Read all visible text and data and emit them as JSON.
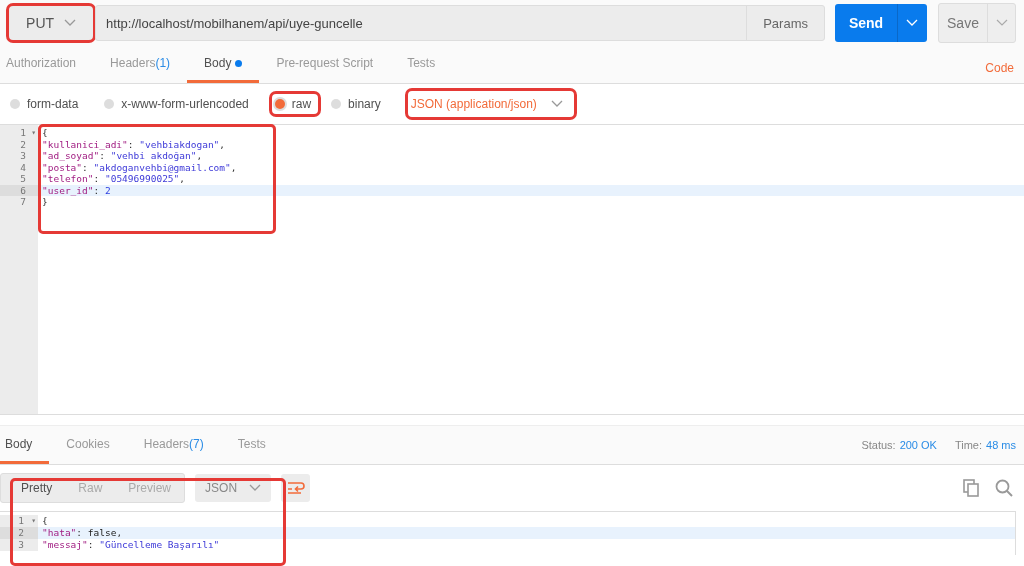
{
  "request": {
    "method": "PUT",
    "method_highlighted": true,
    "url": "http://localhost/mobilhanem/api/uye-guncelle",
    "params_button": "Params",
    "send_button": "Send",
    "save_button": "Save"
  },
  "request_tabs": [
    {
      "label": "Authorization",
      "dot": false,
      "selected": false
    },
    {
      "label": "Headers",
      "count": "(1)",
      "dot": false,
      "selected": false
    },
    {
      "label": "Body",
      "dot": true,
      "selected": true
    },
    {
      "label": "Pre-request Script",
      "dot": false,
      "selected": false
    },
    {
      "label": "Tests",
      "dot": false,
      "selected": false
    }
  ],
  "code_link": "Code",
  "body_types": [
    {
      "label": "form-data",
      "selected": false,
      "highlighted": false
    },
    {
      "label": "x-www-form-urlencoded",
      "selected": false,
      "highlighted": false
    },
    {
      "label": "raw",
      "selected": true,
      "highlighted": true
    },
    {
      "label": "binary",
      "selected": false,
      "highlighted": false
    }
  ],
  "content_type": {
    "label": "JSON (application/json)",
    "highlighted": true
  },
  "request_body": {
    "highlighted": true,
    "lines": [
      {
        "number": "1",
        "fold": "▾",
        "current": false,
        "tokens": [
          {
            "kind": "punct",
            "text": "{"
          }
        ]
      },
      {
        "number": "2",
        "current": false,
        "tokens": [
          {
            "kind": "key",
            "text": "\"kullanici_adi\""
          },
          {
            "kind": "punct",
            "text": ": "
          },
          {
            "kind": "string",
            "text": "\"vehbiakdogan\""
          },
          {
            "kind": "punct",
            "text": ","
          }
        ]
      },
      {
        "number": "3",
        "current": false,
        "tokens": [
          {
            "kind": "key",
            "text": "\"ad_soyad\""
          },
          {
            "kind": "punct",
            "text": ": "
          },
          {
            "kind": "string",
            "text": "\"vehbi akdoğan\""
          },
          {
            "kind": "punct",
            "text": ","
          }
        ]
      },
      {
        "number": "4",
        "current": false,
        "tokens": [
          {
            "kind": "key",
            "text": "\"posta\""
          },
          {
            "kind": "punct",
            "text": ": "
          },
          {
            "kind": "string",
            "text": "\"akdoganvehbi@gmail.com\""
          },
          {
            "kind": "punct",
            "text": ","
          }
        ]
      },
      {
        "number": "5",
        "current": false,
        "tokens": [
          {
            "kind": "key",
            "text": "\"telefon\""
          },
          {
            "kind": "punct",
            "text": ": "
          },
          {
            "kind": "string",
            "text": "\"05496990025\""
          },
          {
            "kind": "punct",
            "text": ","
          }
        ]
      },
      {
        "number": "6",
        "current": true,
        "tokens": [
          {
            "kind": "key",
            "text": "\"user_id\""
          },
          {
            "kind": "punct",
            "text": ": "
          },
          {
            "kind": "number",
            "text": "2"
          }
        ]
      },
      {
        "number": "7",
        "current": false,
        "tokens": [
          {
            "kind": "punct",
            "text": "}"
          }
        ]
      }
    ]
  },
  "response_tabs": [
    {
      "label": "Body",
      "selected": true
    },
    {
      "label": "Cookies",
      "selected": false
    },
    {
      "label": "Headers",
      "count": "(7)",
      "selected": false
    },
    {
      "label": "Tests",
      "selected": false
    }
  ],
  "status": {
    "label": "Status:",
    "value": "200 OK"
  },
  "time": {
    "label": "Time:",
    "value": "48 ms"
  },
  "view_modes": [
    {
      "label": "Pretty",
      "selected": true
    },
    {
      "label": "Raw",
      "selected": false
    },
    {
      "label": "Preview",
      "selected": false
    }
  ],
  "format": "JSON",
  "response_body": {
    "highlighted": true,
    "lines": [
      {
        "number": "1",
        "fold": "▾",
        "current": false,
        "tokens": [
          {
            "kind": "punct",
            "text": "{"
          }
        ]
      },
      {
        "number": "2",
        "current": true,
        "tokens": [
          {
            "kind": "key",
            "text": "\"hata\""
          },
          {
            "kind": "punct",
            "text": ": "
          },
          {
            "kind": "literal",
            "text": "false"
          },
          {
            "kind": "punct",
            "text": ","
          }
        ]
      },
      {
        "number": "3",
        "current": false,
        "tokens": [
          {
            "kind": "key",
            "text": "\"messaj\""
          },
          {
            "kind": "punct",
            "text": ": "
          },
          {
            "kind": "string",
            "text": "\"Güncelleme Başarılı\""
          }
        ]
      }
    ]
  }
}
